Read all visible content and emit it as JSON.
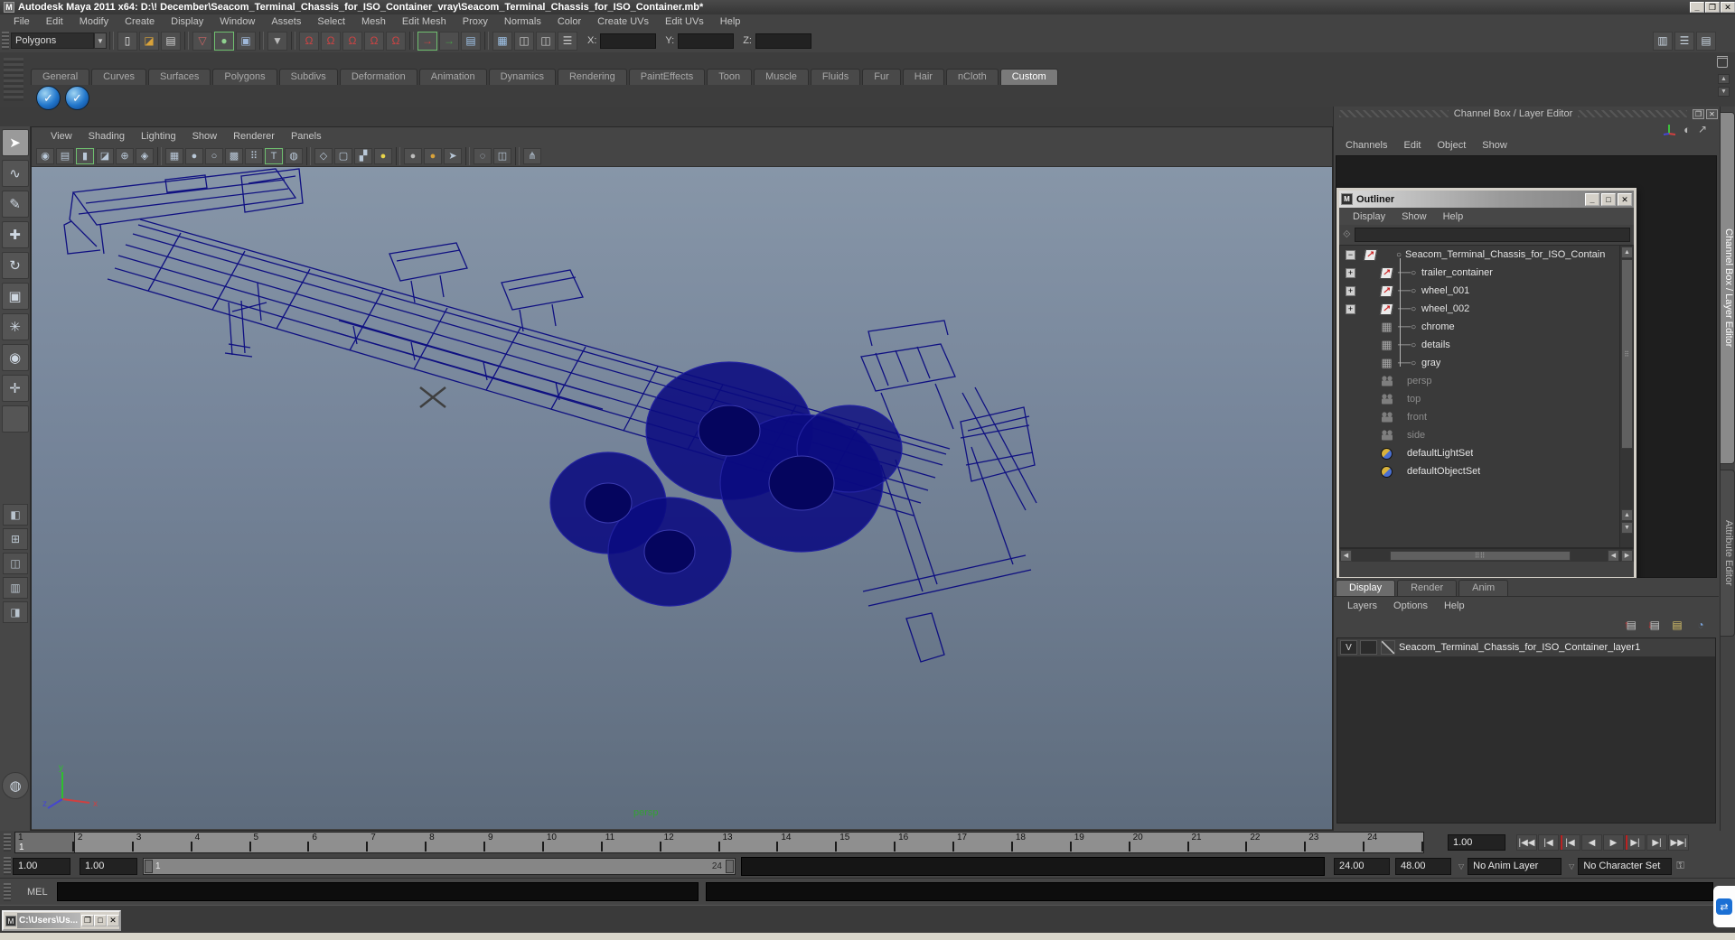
{
  "window": {
    "title": "Autodesk Maya 2011 x64: D:\\! December\\Seacom_Terminal_Chassis_for_ISO_Container_vray\\Seacom_Terminal_Chassis_for_ISO_Container.mb*"
  },
  "menu_bar": {
    "items": [
      "File",
      "Edit",
      "Modify",
      "Create",
      "Display",
      "Window",
      "Assets",
      "Select",
      "Mesh",
      "Edit Mesh",
      "Proxy",
      "Normals",
      "Color",
      "Create UVs",
      "Edit UVs",
      "Help"
    ]
  },
  "toolbar": {
    "menu_set": "Polygons",
    "coords": {
      "x_label": "X:",
      "y_label": "Y:",
      "z_label": "Z:",
      "x_value": "",
      "y_value": "",
      "z_value": ""
    },
    "groups": [
      {
        "icons": [
          "new-scene-icon",
          "open-scene-icon",
          "save-scene-icon"
        ]
      },
      {
        "icons": [
          "select-by-hierarchy-icon",
          "select-by-object-icon",
          "select-by-component-icon"
        ]
      },
      {
        "icons": [
          "selection-mask-icon"
        ]
      },
      {
        "icons": [
          "snap-to-grids-icon",
          "snap-to-curves-icon",
          "snap-to-points-icon",
          "snap-to-view-planes-icon",
          "make-live-icon"
        ]
      },
      {
        "icons": [
          "input-to-selected-icon",
          "output-from-selected-icon",
          "construction-history-icon"
        ]
      },
      {
        "icons": [
          "open-render-view-icon",
          "render-current-frame-icon",
          "ipr-render-icon",
          "render-settings-icon"
        ]
      }
    ],
    "right_icons": [
      "show-channel-box-icon",
      "show-tool-settings-icon",
      "show-attribute-editor-icon"
    ]
  },
  "shelf": {
    "tabs": [
      "General",
      "Curves",
      "Surfaces",
      "Polygons",
      "Subdivs",
      "Deformation",
      "Animation",
      "Dynamics",
      "Rendering",
      "PaintEffects",
      "Toon",
      "Muscle",
      "Fluids",
      "Fur",
      "Hair",
      "nCloth",
      "Custom"
    ],
    "active_tab": "Custom",
    "buttons": [
      "shelf-item-1",
      "shelf-item-2"
    ]
  },
  "toolbox": {
    "tools": [
      "select-tool",
      "lasso-tool",
      "paint-selection-tool",
      "move-tool",
      "rotate-tool",
      "scale-tool",
      "universal-manipulator-tool",
      "soft-modification-tool",
      "show-manipulator-tool",
      "last-tool-slot"
    ],
    "active_tool": "select-tool",
    "layouts": [
      "single-pane-layout",
      "four-pane-layout",
      "persp-outliner-layout",
      "hypergraph-persp-layout",
      "persp-graph-layout"
    ]
  },
  "viewport": {
    "menus": [
      "View",
      "Shading",
      "Lighting",
      "Show",
      "Renderer",
      "Panels"
    ],
    "icons": [
      "select-camera-icon",
      "camera-attributes-icon",
      "bookmarks-icon",
      "image-plane-icon",
      "2d-pan-zoom-icon",
      "grid-icon",
      "film-gate-icon",
      "shading-smooth-icon",
      "shading-flat-icon",
      "wireframe-icon",
      "shading-points-icon",
      "textured-icon",
      "default-material-icon",
      "wireframe-on-shaded-icon",
      "xray-icon",
      "checker-icon",
      "lights-all-icon",
      "lights-default-icon",
      "lights-selected-icon",
      "select-objects-icon",
      "isolate-select-icon",
      "multi-pane-icon",
      "share-icon"
    ],
    "camera_label": "persp",
    "axis": {
      "x": "x",
      "y": "y",
      "z": "z"
    }
  },
  "channel_box": {
    "header": "Channel Box / Layer Editor",
    "menus": [
      "Channels",
      "Edit",
      "Object",
      "Show"
    ],
    "vertical_tabs": [
      {
        "label": "Channel Box / Layer Editor",
        "active": true
      },
      {
        "label": "Attribute Editor",
        "active": false
      }
    ]
  },
  "outliner": {
    "title": "Outliner",
    "menus": [
      "Display",
      "Show",
      "Help"
    ],
    "search_value": "",
    "items": [
      {
        "label": "Seacom_Terminal_Chassis_for_ISO_Contain",
        "type": "transform",
        "expand": "minus",
        "root": true
      },
      {
        "label": "trailer_container",
        "type": "transform",
        "expand": "plus",
        "child": true
      },
      {
        "label": "wheel_001",
        "type": "transform",
        "expand": "plus",
        "child": true
      },
      {
        "label": "wheel_002",
        "type": "transform",
        "expand": "plus",
        "child": true
      },
      {
        "label": "chrome",
        "type": "mesh",
        "child": true
      },
      {
        "label": "details",
        "type": "mesh",
        "child": true
      },
      {
        "label": "gray",
        "type": "mesh",
        "child": true,
        "last": true
      },
      {
        "label": "persp",
        "type": "camera",
        "muted": true
      },
      {
        "label": "top",
        "type": "camera",
        "muted": true
      },
      {
        "label": "front",
        "type": "camera",
        "muted": true
      },
      {
        "label": "side",
        "type": "camera",
        "muted": true
      },
      {
        "label": "defaultLightSet",
        "type": "set"
      },
      {
        "label": "defaultObjectSet",
        "type": "set"
      }
    ]
  },
  "layer_editor": {
    "tabs": [
      "Display",
      "Render",
      "Anim"
    ],
    "active_tab": "Display",
    "menus": [
      "Layers",
      "Options",
      "Help"
    ],
    "icons": [
      "move-layer-up-icon",
      "move-layer-down-icon",
      "create-empty-layer-icon",
      "create-layer-from-selected-icon"
    ],
    "layers": [
      {
        "visibility": "V",
        "name": "Seacom_Terminal_Chassis_for_ISO_Container_layer1"
      }
    ]
  },
  "timeline": {
    "frames": [
      "1",
      "2",
      "3",
      "4",
      "5",
      "6",
      "7",
      "8",
      "9",
      "10",
      "11",
      "12",
      "13",
      "14",
      "15",
      "16",
      "17",
      "18",
      "19",
      "20",
      "21",
      "22",
      "23",
      "24"
    ],
    "current_frame": "1",
    "playback_speed": "1.00",
    "playback_buttons": [
      "go-to-start-button",
      "step-back-frame-button",
      "step-back-key-button",
      "play-backwards-button",
      "play-forwards-button",
      "step-forward-key-button",
      "step-forward-frame-button",
      "go-to-end-button"
    ]
  },
  "range_slider": {
    "field_1": "1.00",
    "field_2": "1.00",
    "range_start_handle": "1",
    "range_end_handle": "24",
    "playback_end": "24.00",
    "anim_end": "48.00",
    "anim_layer": "No Anim Layer",
    "character_set": "No Character Set"
  },
  "command_line": {
    "label": "MEL",
    "value": ""
  },
  "taskbar": {
    "minimized_window_title": "C:\\Users\\Us..."
  },
  "colors": {
    "wireframe": "#0a0a80",
    "viewport_top": "#8796a8",
    "viewport_bottom": "#5e6c7d",
    "selection_green": "#6fbf6f",
    "classic_gray": "#d4d0c8"
  }
}
